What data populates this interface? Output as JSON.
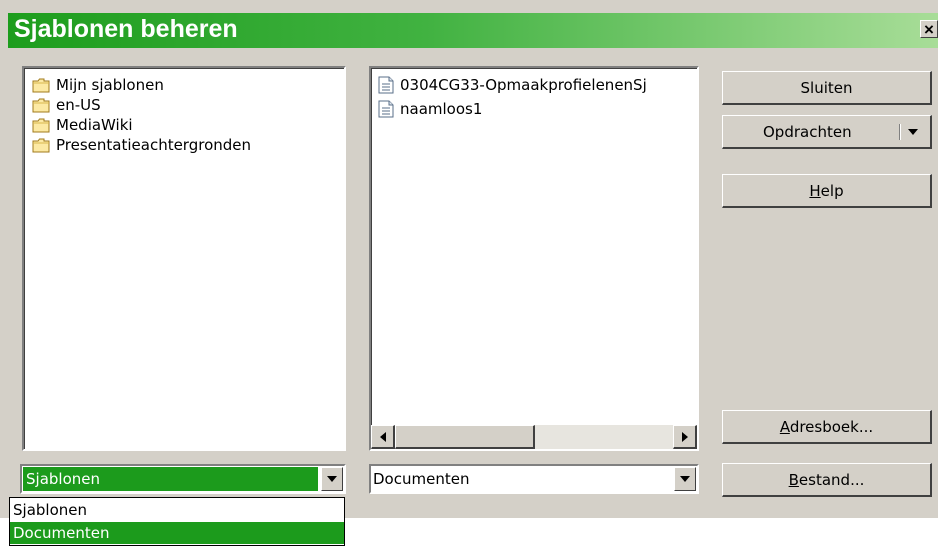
{
  "window": {
    "title": "Sjablonen beheren",
    "close_label": "×"
  },
  "left_list": {
    "items": [
      {
        "label": "Mijn sjablonen",
        "icon": "folder-icon"
      },
      {
        "label": "en-US",
        "icon": "folder-icon"
      },
      {
        "label": "MediaWiki",
        "icon": "folder-icon"
      },
      {
        "label": "Presentatieachtergronden",
        "icon": "folder-icon"
      }
    ]
  },
  "right_list": {
    "items": [
      {
        "label": "0304CG33-OpmaakprofielenenSj",
        "icon": "document-icon"
      },
      {
        "label": "naamloos1",
        "icon": "document-icon"
      }
    ]
  },
  "buttons": {
    "close": "Sluiten",
    "commands": "Opdrachten",
    "help_prefix": "",
    "help_accel": "H",
    "help_rest": "elp",
    "addressbook_accel": "A",
    "addressbook_rest": "dresboek...",
    "file_accel": "B",
    "file_rest": "estand..."
  },
  "left_combo": {
    "value": "Sjablonen",
    "options": [
      "Sjablonen",
      "Documenten"
    ],
    "highlighted": "Documenten"
  },
  "right_combo": {
    "value": "Documenten"
  },
  "colors": {
    "accent": "#1c9b1c",
    "face": "#d4d0c8",
    "title_text": "#ffffff"
  }
}
